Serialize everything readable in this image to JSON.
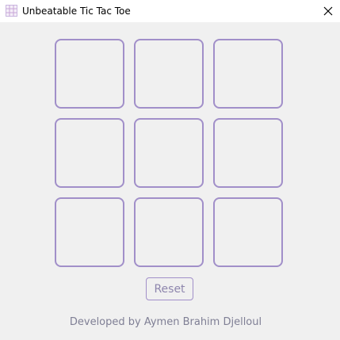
{
  "window": {
    "title": "Unbeatable Tic Tac Toe",
    "app_icon": "grid-app-icon",
    "close_icon": "close-icon"
  },
  "board": {
    "cells": [
      "",
      "",
      "",
      "",
      "",
      "",
      "",
      "",
      ""
    ]
  },
  "controls": {
    "reset_label": "Reset"
  },
  "footer": {
    "credit": "Developed by Aymen Brahim Djelloul"
  },
  "colors": {
    "accent": "#a18fc9",
    "background": "#f0f0f0",
    "footer_text": "#7f7f95"
  }
}
